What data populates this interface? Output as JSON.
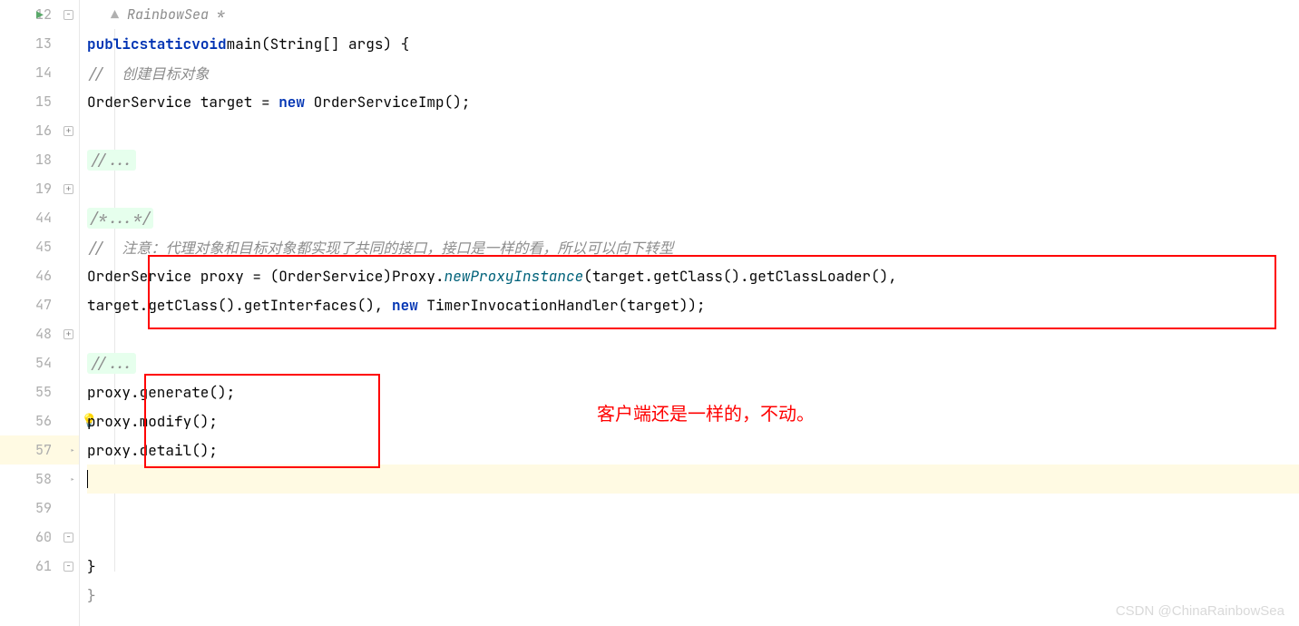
{
  "author": {
    "label": "RainbowSea *"
  },
  "lineNumbers": [
    "12",
    "13",
    "14",
    "15",
    "16",
    "18",
    "19",
    "44",
    "45",
    "46",
    "47",
    "48",
    "54",
    "55",
    "56",
    "57",
    "58",
    "59",
    "60",
    "61"
  ],
  "code": {
    "l12": {
      "kw1": "public",
      "kw2": "static",
      "kw3": "void",
      "method": "main",
      "params": "(String[] args) {"
    },
    "l13_comment": "//  创建目标对象",
    "l14": {
      "t1": "OrderService target = ",
      "kw": "new",
      "t2": " OrderServiceImp();"
    },
    "l16_fold": "//...",
    "l19_fold": "/*...*/",
    "l44_comment": "//  注意：代理对象和目标对象都实现了共同的接口，接口是一样的看，所以可以向下转型",
    "l45": {
      "t1": "OrderService proxy = (OrderService)Proxy.",
      "m": "newProxyInstance",
      "t2": "(target.getClass().getClassLoader(),"
    },
    "l46": {
      "t1": "target.getClass().getInterfaces(), ",
      "kw": "new",
      "t2": " TimerInvocationHandler(target));"
    },
    "l48_fold": "//...",
    "l54": "proxy.generate();",
    "l55": "proxy.modify();",
    "l56": "proxy.detail();",
    "l60_brace": "}",
    "l61_brace": "}"
  },
  "annotation": "客户端还是一样的，不动。",
  "watermark": "CSDN @ChinaRainbowSea"
}
